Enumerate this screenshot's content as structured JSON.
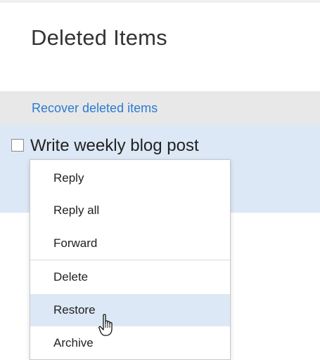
{
  "page": {
    "title": "Deleted Items"
  },
  "recover": {
    "link_label": "Recover deleted items"
  },
  "message": {
    "subject": "Write weekly blog post"
  },
  "context_menu": {
    "items": [
      {
        "label": "Reply"
      },
      {
        "label": "Reply all"
      },
      {
        "label": "Forward"
      },
      {
        "label": "Delete"
      },
      {
        "label": "Restore"
      },
      {
        "label": "Archive"
      }
    ],
    "hovered": "Restore"
  },
  "colors": {
    "link": "#2a7bd1",
    "selection": "#dce8f6",
    "bar": "#e8e8e8"
  },
  "icons": {
    "cursor": "hand-pointer-icon"
  }
}
